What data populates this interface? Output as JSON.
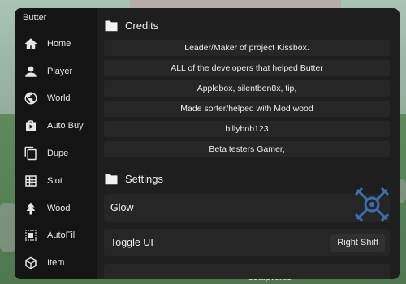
{
  "app": {
    "title": "Butter"
  },
  "sidebar": {
    "items": [
      {
        "label": "Home",
        "icon": "home-icon"
      },
      {
        "label": "Player",
        "icon": "user-icon"
      },
      {
        "label": "World",
        "icon": "globe-icon"
      },
      {
        "label": "Auto Buy",
        "icon": "shopping-bag-icon"
      },
      {
        "label": "Dupe",
        "icon": "copy-icon"
      },
      {
        "label": "Slot",
        "icon": "grid-icon"
      },
      {
        "label": "Wood",
        "icon": "tree-icon"
      },
      {
        "label": "AutoFill",
        "icon": "select-dotted-icon"
      },
      {
        "label": "Item",
        "icon": "cube-icon"
      }
    ]
  },
  "credits": {
    "title": "Credits",
    "rows": [
      "Leader/Maker of project Kissbox.",
      "ALL of the developers that helped Butter",
      "Applebox, silentben8x, tip,",
      "Made sorter/helped with Mod wood",
      "billybob123",
      "Beta testers Gamer,"
    ]
  },
  "settings": {
    "title": "Settings",
    "glow_label": "Glow",
    "toggle_ui_label": "Toggle UI",
    "toggle_ui_key": "Right Shift"
  },
  "background": {
    "caption": "setupvalue"
  },
  "colors": {
    "window": "#1c1c1c",
    "sidebar": "#141414",
    "row": "#262626",
    "emblem": "#3b6fb0"
  }
}
